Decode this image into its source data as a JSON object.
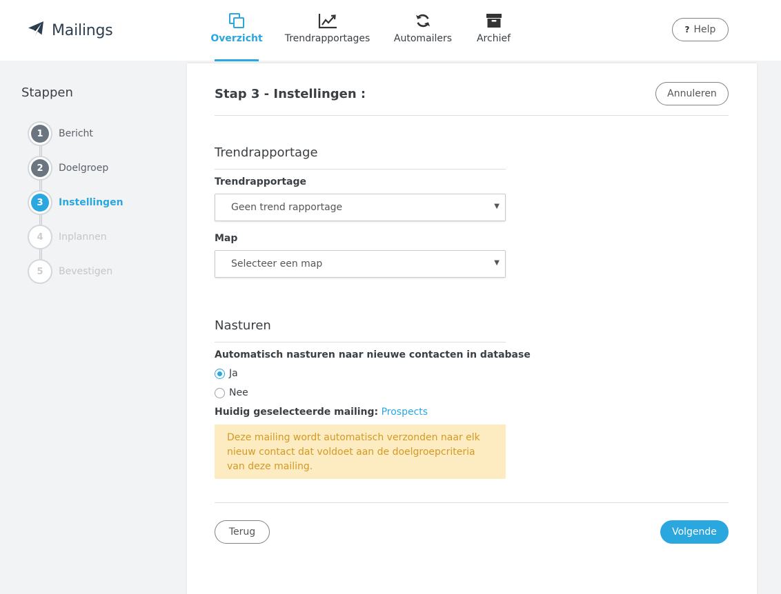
{
  "header": {
    "app_title": "Mailings",
    "brand_icon": "paper-plane-icon",
    "tabs": [
      {
        "label": "Overzicht",
        "icon": "copy-icon",
        "active": true
      },
      {
        "label": "Trendrapportages",
        "icon": "line-chart-icon",
        "active": false
      },
      {
        "label": "Automailers",
        "icon": "refresh-icon",
        "active": false
      },
      {
        "label": "Archief",
        "icon": "archive-icon",
        "active": false
      }
    ],
    "help_label": "Help",
    "help_icon_text": "?"
  },
  "sidebar": {
    "title": "Stappen",
    "steps": [
      {
        "number": "1",
        "label": "Bericht",
        "state": "done"
      },
      {
        "number": "2",
        "label": "Doelgroep",
        "state": "done"
      },
      {
        "number": "3",
        "label": "Instellingen",
        "state": "current"
      },
      {
        "number": "4",
        "label": "Inplannen",
        "state": "todo"
      },
      {
        "number": "5",
        "label": "Bevestigen",
        "state": "todo"
      }
    ]
  },
  "main": {
    "title": "Stap 3 - Instellingen :",
    "cancel_label": "Annuleren",
    "trend_section": {
      "title": "Trendrapportage",
      "trend_label": "Trendrapportage",
      "trend_value": "Geen trend rapportage",
      "map_label": "Map",
      "map_value": "Selecteer een map"
    },
    "resend_section": {
      "title": "Nasturen",
      "question": "Automatisch nasturen naar nieuwe contacten in database",
      "options": [
        {
          "label": "Ja",
          "checked": true
        },
        {
          "label": "Nee",
          "checked": false
        }
      ],
      "current_mailing_label": "Huidig geselecteerde mailing:",
      "current_mailing_value": "Prospects",
      "alert_text": "Deze mailing wordt automatisch verzonden naar elk nieuw contact dat voldoet aan de doelgroepcriteria van deze mailing."
    },
    "back_label": "Terug",
    "next_label": "Volgende"
  },
  "colors": {
    "accent": "#2aa7df",
    "step_done": "#6b7580",
    "alert_bg": "#fdebc2",
    "alert_text": "#d39a24",
    "brand": "#2c3e50"
  }
}
